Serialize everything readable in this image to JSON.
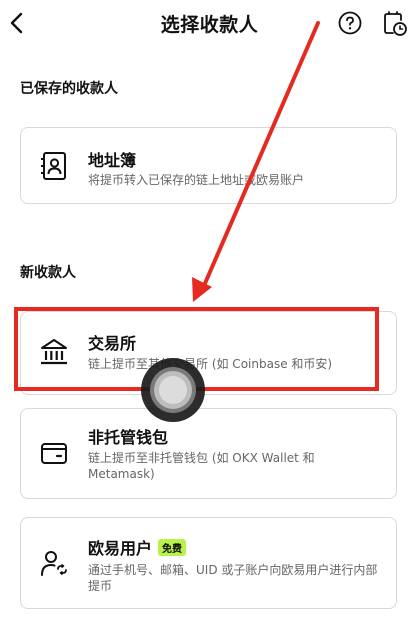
{
  "header": {
    "title": "选择收款人",
    "back_icon": "chevron-left-icon",
    "help_icon": "question-circle-icon",
    "history_icon": "history-clock-icon"
  },
  "sections": {
    "saved_label": "已保存的收款人",
    "new_label": "新收款人"
  },
  "saved": {
    "address_book": {
      "title": "地址簿",
      "desc": "将提币转入已保存的链上地址或欧易账户",
      "icon": "contact-book-icon"
    }
  },
  "new": {
    "exchange": {
      "title": "交易所",
      "desc": "链上提币至其他交易所 (如 Coinbase 和币安)",
      "icon": "bank-building-icon"
    },
    "wallet": {
      "title": "非托管钱包",
      "desc": "链上提币至非托管钱包 (如 OKX Wallet 和 Metamask)",
      "icon": "wallet-icon"
    },
    "okx_user": {
      "title": "欧易用户",
      "badge": "免费",
      "desc": "通过手机号、邮箱、UID 或子账户向欧易用户进行内部提币",
      "icon": "user-swap-icon"
    }
  },
  "colors": {
    "highlight": "#e52b21",
    "badge": "#b9f24a",
    "border": "#d9d9d9",
    "secondary_text": "#666666"
  }
}
